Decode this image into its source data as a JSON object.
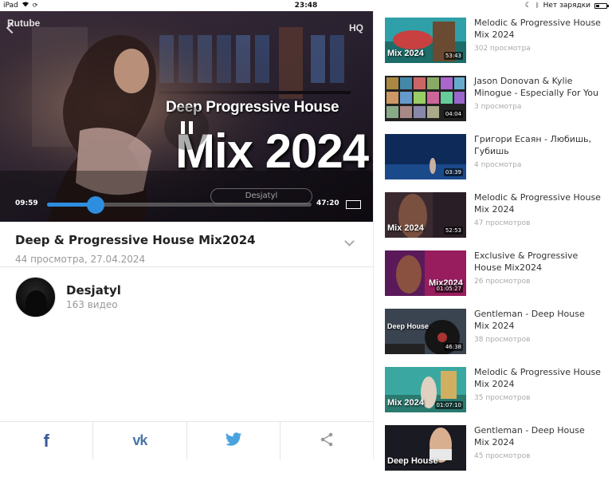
{
  "status_bar": {
    "device": "iPad",
    "time": "23:48",
    "battery_text": "Нет зарядки"
  },
  "player": {
    "brand": "Rutube",
    "quality": "HQ",
    "overlay_title_line1": "Deep Progressive House",
    "overlay_title_line2": "Mix 2024",
    "channel_pill": "Desjatyl",
    "current_time": "09:59",
    "duration": "47:20",
    "progress": 0.185,
    "state": "playing"
  },
  "video": {
    "title": "Deep & Progressive House Mix2024",
    "meta": "44 просмотра, 27.04.2024"
  },
  "channel": {
    "name": "Desjatyl",
    "video_count": "163 видео"
  },
  "share": {
    "facebook_icon": "facebook-icon",
    "vk_icon": "vk-icon",
    "twitter_icon": "twitter-icon",
    "share_icon": "share-icon"
  },
  "related": [
    {
      "title": "Melodic & Progressive House Mix 2024",
      "views": "302 просмотра",
      "duration": "53:43",
      "thumb_text": "Mix 2024"
    },
    {
      "title": "Jason Donovan & Kylie Minogue - Especially For You",
      "views": "3 просмотра",
      "duration": "04:04",
      "thumb_text": ""
    },
    {
      "title": "Григори Есаян - Любишь, Губишь",
      "views": "4 просмотра",
      "duration": "03:39",
      "thumb_text": ""
    },
    {
      "title": "Melodic & Progressive House Mix 2024",
      "views": "47 просмотров",
      "duration": "52:53",
      "thumb_text": "Mix 2024"
    },
    {
      "title": "Exclusive & Progressive House Mix2024",
      "views": "26 просмотров",
      "duration": "01:05:27",
      "thumb_text": "Mix2024"
    },
    {
      "title": "Gentleman - Deep House Mix 2024",
      "views": "38 просмотров",
      "duration": "46:38",
      "thumb_text": "Deep House"
    },
    {
      "title": "Melodic & Progressive House Mix 2024",
      "views": "35 просмотров",
      "duration": "01:07:10",
      "thumb_text": "Mix 2024"
    },
    {
      "title": "Gentleman - Deep House Mix 2024",
      "views": "45 просмотров",
      "duration": "",
      "thumb_text": "Deep House"
    }
  ]
}
